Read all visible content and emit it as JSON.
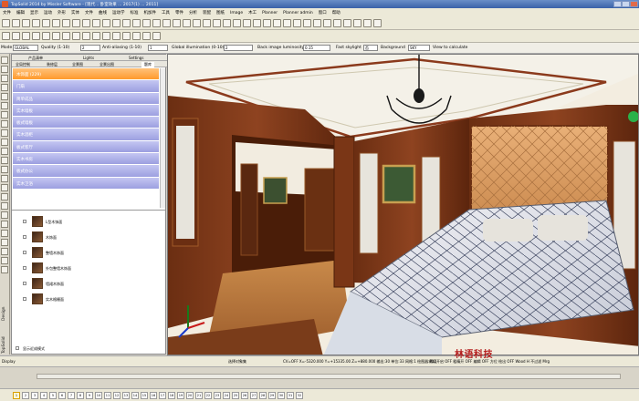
{
  "window": {
    "title": "TopSolid 2014 by Missler Software - [现代... 卧室效果 ... 2017(1) ... 2011]",
    "brand_colors": {
      "title_bar": "#3a62a8",
      "category_selected": "#ff9a2c",
      "category": "#9c9fe0"
    }
  },
  "menu": [
    "文件",
    "编辑",
    "显示",
    "运动",
    "外形",
    "实体",
    "文件",
    "曲线",
    "运动学",
    "标准",
    "机加件",
    "工具",
    "零件",
    "分析",
    "装配",
    "图纸",
    "Image",
    "木工",
    "Planner",
    "Planner admin",
    "窗口",
    "帮助"
  ],
  "options": {
    "mode_label": "Mode",
    "mode_value": "GLOBAL",
    "quality_label": "Quality (1-10)",
    "quality_value": "2",
    "antialias_label": "Anti-aliasing (1-10)",
    "antialias_value": "1",
    "gi_label": "Global illumination (0-10)",
    "gi_value": "2",
    "back_lum_label": "Back image luminosity",
    "back_lum_value": "0.15",
    "skylight_label": "Fast skylight",
    "skylight_value": "否",
    "background_label": "Background",
    "background_value": "SKY",
    "calc_label": "View to calculate"
  },
  "panel": {
    "tabs_top": [
      "产品清单",
      "Lights",
      "Settings"
    ],
    "tabs_bottom": [
      "全局控制",
      "装修层",
      "全景图",
      "全景出图",
      "题库"
    ],
    "categories": [
      {
        "label": "木饰面 (229)",
        "selected": true
      },
      {
        "label": "门扇",
        "selected": false
      },
      {
        "label": "简单成品",
        "selected": false
      },
      {
        "label": "实木墙板",
        "selected": false
      },
      {
        "label": "板式墙板",
        "selected": false
      },
      {
        "label": "实木酒柜",
        "selected": false
      },
      {
        "label": "板式客厅",
        "selected": false
      },
      {
        "label": "实木书房",
        "selected": false
      },
      {
        "label": "板式办公",
        "selected": false
      },
      {
        "label": "实木卫浴",
        "selected": false
      }
    ],
    "tree_items": [
      "L型木饰面",
      "木饰面",
      "整墙木饰面",
      "外包整墙木饰面",
      "墙裙木饰面",
      "实木格栅面"
    ],
    "tree_footer": "显示近成模式"
  },
  "side_tabs": [
    "TopSolid",
    "Design"
  ],
  "status": {
    "display": "Display",
    "hint": "选择对象集",
    "coords": "CV=OFF  X=-5320.000  Y=+15335.00  Z=+880.000  输出:30  单位:33  网格:1  绘图器:P12",
    "group": "编组开启 OFF  粗精开 OFF  编辑 OFF  方位 绘出 OFF  Wood H  不过滤 Mrg",
    "watermark": "林语科技"
  },
  "pages": [
    "1",
    "2",
    "3",
    "4",
    "5",
    "6",
    "7",
    "8",
    "9",
    "10",
    "11",
    "12",
    "13",
    "14",
    "15",
    "16",
    "17",
    "18",
    "19",
    "20",
    "21",
    "22",
    "23",
    "24",
    "25",
    "26",
    "27",
    "28",
    "29",
    "30",
    "31",
    "32"
  ],
  "current_page": "1"
}
